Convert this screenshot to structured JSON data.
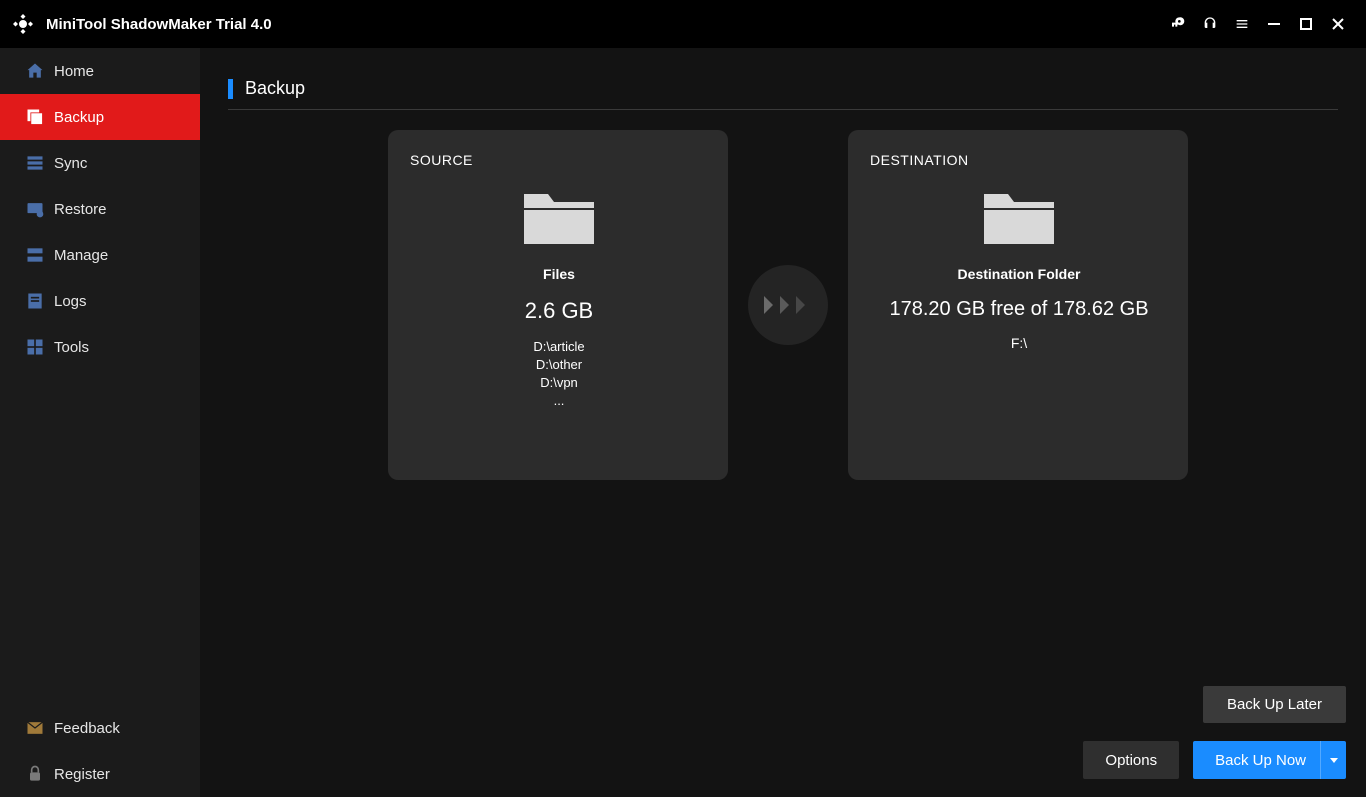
{
  "app": {
    "title": "MiniTool ShadowMaker Trial 4.0"
  },
  "sidebar": {
    "items": [
      {
        "label": "Home"
      },
      {
        "label": "Backup"
      },
      {
        "label": "Sync"
      },
      {
        "label": "Restore"
      },
      {
        "label": "Manage"
      },
      {
        "label": "Logs"
      },
      {
        "label": "Tools"
      }
    ],
    "bottom": [
      {
        "label": "Feedback"
      },
      {
        "label": "Register"
      }
    ]
  },
  "page": {
    "title": "Backup"
  },
  "source": {
    "title": "SOURCE",
    "type": "Files",
    "size": "2.6 GB",
    "paths": [
      "D:\\article",
      "D:\\other",
      "D:\\vpn",
      "..."
    ]
  },
  "destination": {
    "title": "DESTINATION",
    "label": "Destination Folder",
    "space": "178.20 GB free of 178.62 GB",
    "path": "F:\\"
  },
  "footer": {
    "options": "Options",
    "backup_now": "Back Up Now",
    "backup_later": "Back Up Later"
  }
}
